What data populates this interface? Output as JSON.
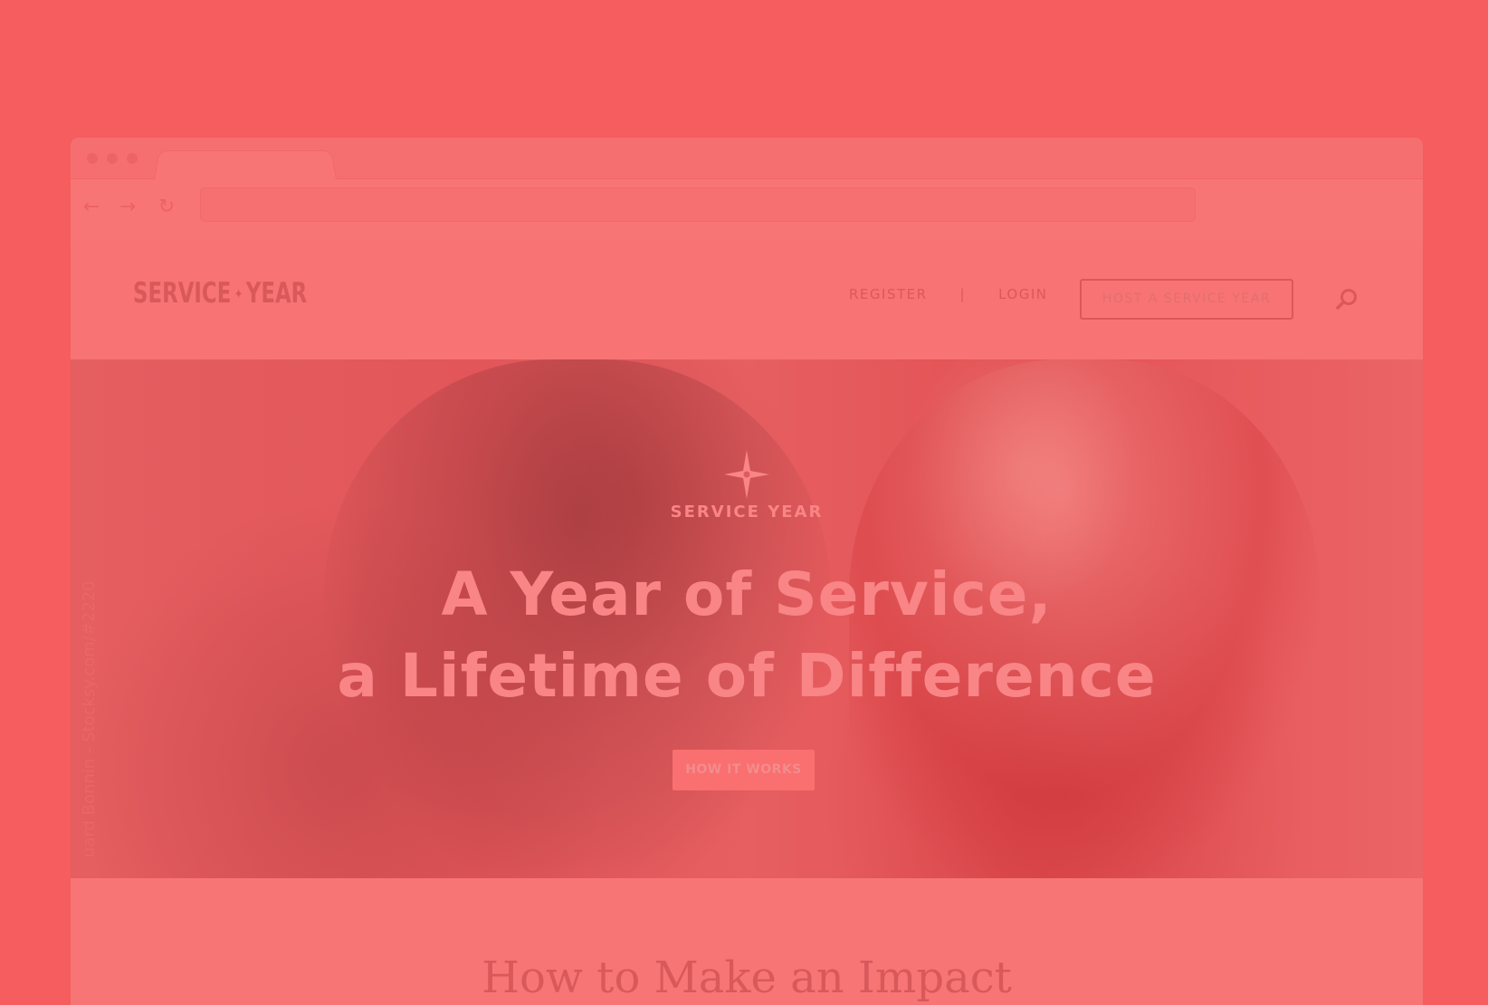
{
  "browser": {
    "nav": {
      "back_glyph": "←",
      "forward_glyph": "→",
      "reload_glyph": "↻"
    },
    "address": {
      "value": "",
      "placeholder": ""
    }
  },
  "header": {
    "logo": {
      "left": "SERVICE",
      "right": "YEAR",
      "star_glyph": "✦"
    },
    "nav": {
      "register": "REGISTER",
      "separator": "|",
      "login": "LOGIN"
    },
    "host_button": "HOST A SERVICE YEAR",
    "search_icon": "search-icon"
  },
  "hero": {
    "brand": "SERVICE YEAR",
    "title_line1": "A Year of Service,",
    "title_line2": "a Lifetime of Difference",
    "cta": "HOW IT WORKS",
    "side_credit": "uard Bonnin - Stocksy.com/#2220"
  },
  "section": {
    "title": "How to Make an Impact"
  },
  "colors": {
    "background": "#f65d5e",
    "browser": "#f87576",
    "text_dark": "#d9595a",
    "hero_text": "#f98586",
    "cta": "#fa6f70"
  }
}
